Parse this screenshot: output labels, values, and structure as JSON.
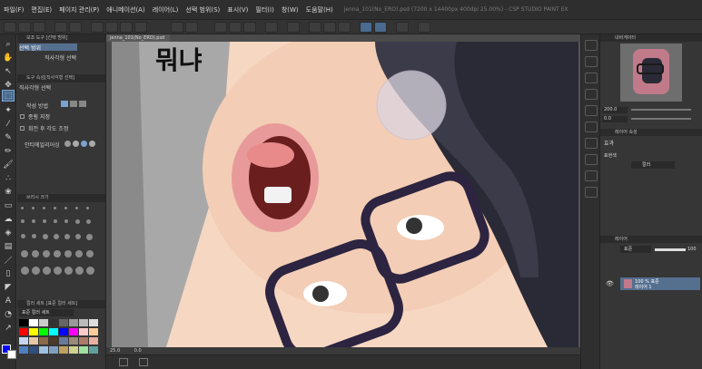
{
  "menu": {
    "items": [
      "파일(F)",
      "편집(E)",
      "페이지 관리(P)",
      "애니메이션(A)",
      "레이어(L)",
      "선택 범위(S)",
      "표시(V)",
      "필터(I)",
      "창(W)",
      "도움말(H)"
    ],
    "title": "jenna_101(No_ERO).psd (7200 x 14400px 400dpi 25.00%) - CSP STUDIO PAINT EX"
  },
  "document": {
    "tab": "jenna_101(No_ERO).psd",
    "status_zoom": "25.0",
    "status_pos": "0.0"
  },
  "left_panel": {
    "tool_property_header": "보조 도구 [선택 범위]",
    "selection_tool_label": "선택 범위",
    "lasso_label": "직사각형 선택",
    "subtool_header": "도구 속성[직사각형 선택]",
    "subtool_name": "직사각형 선택",
    "creation_method_label": "작성 방법",
    "aspect_label": "종횡 지정",
    "rotate_label": "회전 후 각도 조정",
    "antialias_label": "안티에일리어싱",
    "brush_size_header": "브러시 크기",
    "color_header": "컬러 세트 [표준 컬러 세트]",
    "color_set_label": "표준 컬러 세트"
  },
  "right_panel": {
    "navigator_header": "내비게이터",
    "nav_zoom": "200.0",
    "nav_rotation": "0.0",
    "layer_property_header": "레이어 속성",
    "effect_label": "효과",
    "express_label": "표현색",
    "express_value": "컬러",
    "layer_header": "레이어",
    "blend_mode": "표준",
    "opacity": "100",
    "layer_opacity_text": "100 % 표준",
    "layer_name": "레이어 1"
  },
  "canvas": {
    "handwriting": "뭐냐"
  },
  "colors": {
    "accent": "#4a6a8f",
    "selected": "#7aa4d0"
  }
}
